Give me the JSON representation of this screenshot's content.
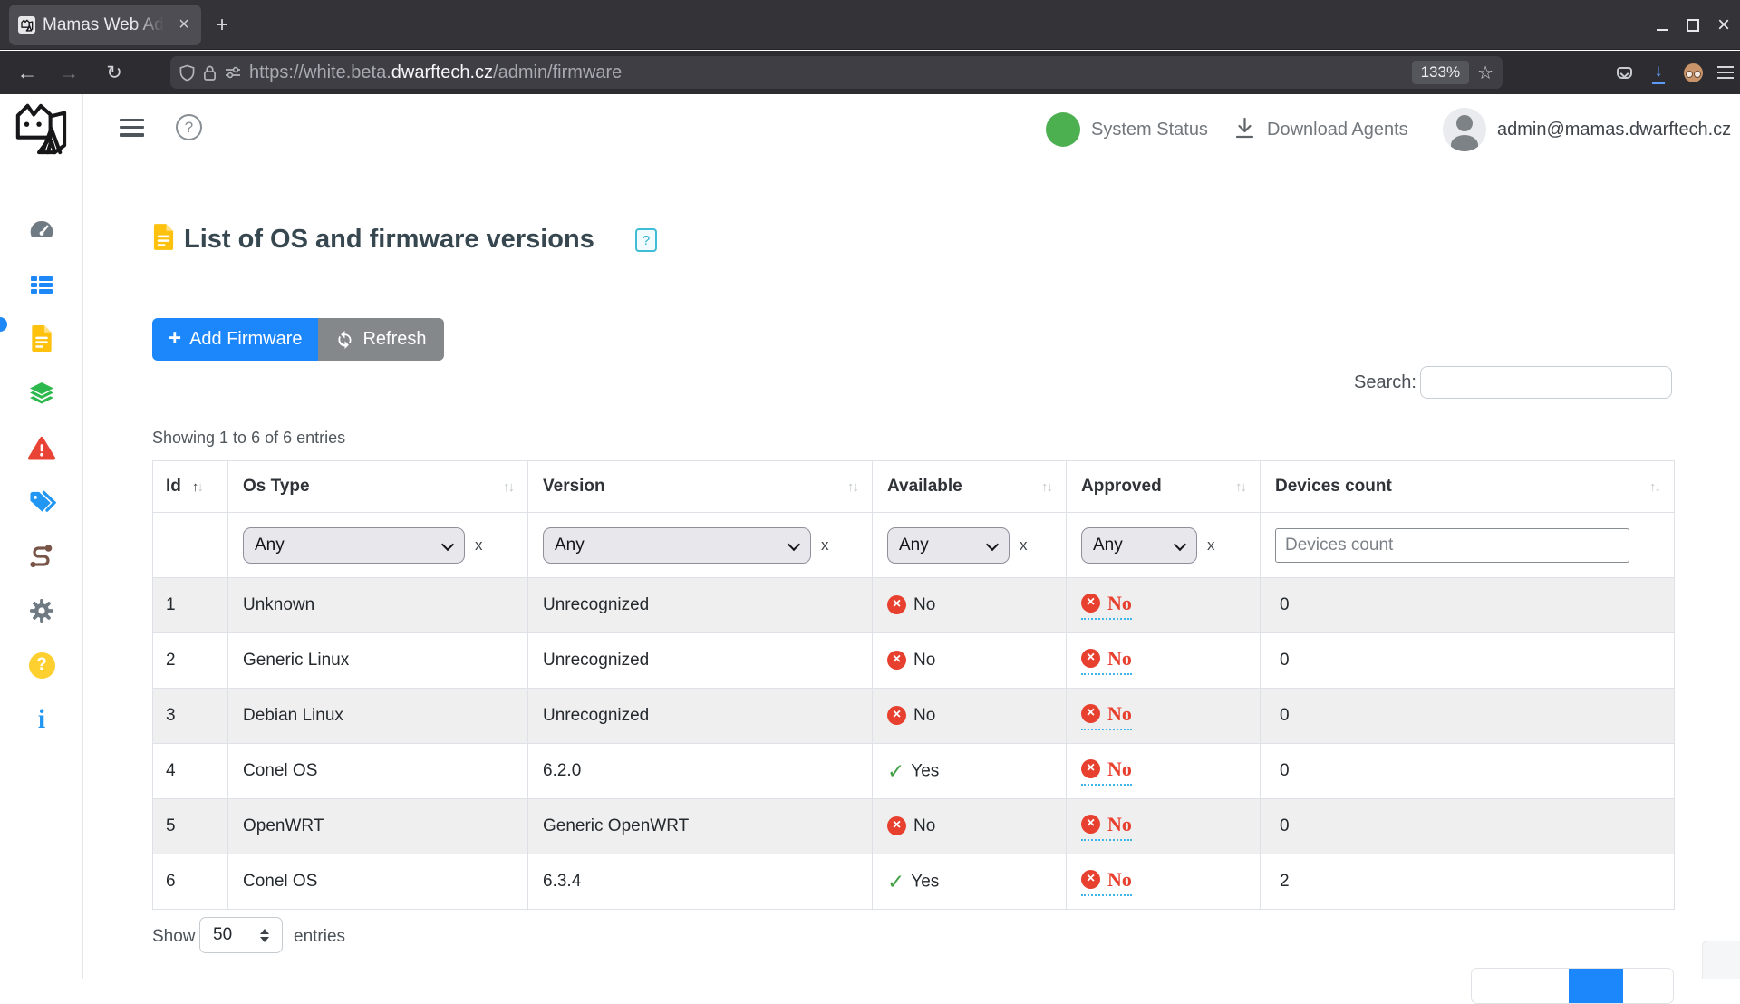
{
  "browser": {
    "tab_title": "Mamas Web Ad",
    "url_prefix": "https://white.beta.",
    "url_domain": "dwarftech.cz",
    "url_path": "/admin/firmware",
    "zoom_level": "133%"
  },
  "app_header": {
    "system_status_label": "System Status",
    "download_agents_label": "Download Agents",
    "user_email": "admin@mamas.dwarftech.cz"
  },
  "sidebar": {
    "icons": [
      "dashboard-icon",
      "device-list-icon",
      "firmware-file-icon",
      "layers-icon",
      "alert-triangle-icon",
      "tags-icon",
      "route-icon",
      "settings-gear-icon",
      "help-circle-icon",
      "info-icon"
    ]
  },
  "page": {
    "title": "List of OS and firmware versions",
    "help_badge": "?",
    "add_firmware_button": "Add Firmware",
    "refresh_button": "Refresh",
    "search_label": "Search:",
    "showing_text": "Showing 1 to 6 of 6 entries",
    "show_label": "Show",
    "entries_label": "entries",
    "page_size": "50"
  },
  "table": {
    "columns": [
      "Id",
      "Os Type",
      "Version",
      "Available",
      "Approved",
      "Devices count"
    ],
    "filter_any": "Any",
    "filter_clear": "x",
    "devices_placeholder": "Devices count",
    "rows": [
      {
        "id": "1",
        "os_type": "Unknown",
        "version": "Unrecognized",
        "available": "No",
        "available_state": "no",
        "approved": "No",
        "approved_state": "no",
        "devices_count": "0"
      },
      {
        "id": "2",
        "os_type": "Generic Linux",
        "version": "Unrecognized",
        "available": "No",
        "available_state": "no",
        "approved": "No",
        "approved_state": "no",
        "devices_count": "0"
      },
      {
        "id": "3",
        "os_type": "Debian Linux",
        "version": "Unrecognized",
        "available": "No",
        "available_state": "no",
        "approved": "No",
        "approved_state": "no",
        "devices_count": "0"
      },
      {
        "id": "4",
        "os_type": "Conel OS",
        "version": "6.2.0",
        "available": "Yes",
        "available_state": "yes",
        "approved": "No",
        "approved_state": "no",
        "devices_count": "0"
      },
      {
        "id": "5",
        "os_type": "OpenWRT",
        "version": "Generic OpenWRT",
        "available": "No",
        "available_state": "no",
        "approved": "No",
        "approved_state": "no",
        "devices_count": "0"
      },
      {
        "id": "6",
        "os_type": "Conel OS",
        "version": "6.3.4",
        "available": "Yes",
        "available_state": "yes",
        "approved": "No",
        "approved_state": "no",
        "devices_count": "2"
      }
    ]
  },
  "colors": {
    "primary_blue": "#1b87fa",
    "gray_button": "#84888b",
    "status_green": "#4caf50",
    "error_red": "#e8402f",
    "success_green": "#43a047",
    "help_cyan": "#3fbdd6"
  }
}
